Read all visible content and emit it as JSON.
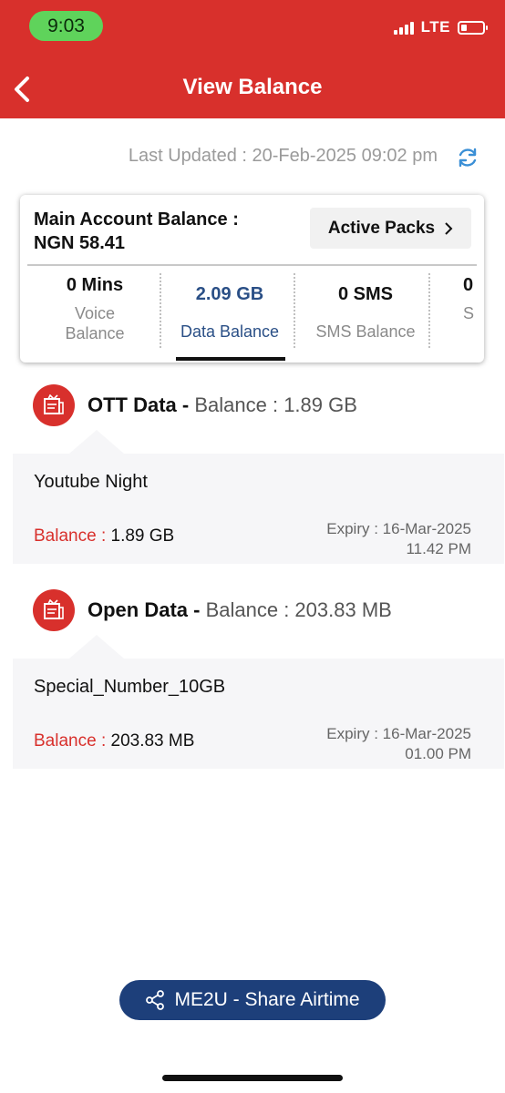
{
  "status_bar": {
    "time": "9:03",
    "network": "LTE",
    "battery_level_pct": 25
  },
  "header": {
    "title": "View Balance"
  },
  "last_updated": "Last Updated : 20-Feb-2025 09:02 pm",
  "account": {
    "title": "Main Account Balance :",
    "amount": "NGN 58.41",
    "active_packs_label": "Active Packs"
  },
  "tiles": [
    {
      "value": "0 Mins",
      "label_line1": "Voice",
      "label_line2": "Balance"
    },
    {
      "value": "2.09 GB",
      "label": "Data Balance",
      "selected": true
    },
    {
      "value": "0 SMS",
      "label": "SMS Balance"
    },
    {
      "value": "0",
      "label": "S"
    }
  ],
  "sections": [
    {
      "title": "OTT Data -",
      "balance": "Balance : 1.89 GB",
      "pack_name": "Youtube Night",
      "balance_label": "Balance :",
      "balance_value": "1.89 GB",
      "expiry_line1": "Expiry : 16-Mar-2025",
      "expiry_line2": "11.42 PM"
    },
    {
      "title": "Open Data -",
      "balance": "Balance : 203.83 MB",
      "pack_name": "Special_Number_10GB",
      "balance_label": "Balance :",
      "balance_value": "203.83 MB",
      "expiry_line1": "Expiry : 16-Mar-2025",
      "expiry_line2": "01.00 PM"
    }
  ],
  "share_button": {
    "label": "ME2U - Share Airtime"
  },
  "colors": {
    "brand_red": "#d8302c",
    "accent_blue": "#1d3f7a",
    "data_blue": "#2a4f86",
    "refresh_blue": "#3a8fd6"
  }
}
